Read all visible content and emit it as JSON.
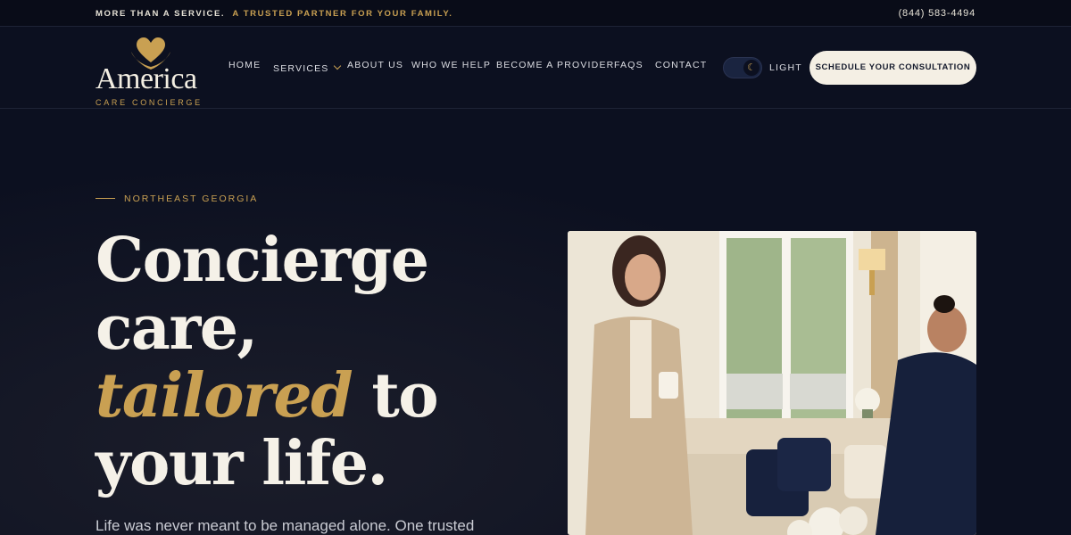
{
  "topbar": {
    "tagline_part1": "MORE THAN A SERVICE.",
    "tagline_part2": "A TRUSTED PARTNER FOR YOUR FAMILY.",
    "phone": "(844) 583-4494"
  },
  "logo": {
    "name": "America",
    "sub": "CARE CONCIERGE",
    "icon": "heart-hands-icon"
  },
  "nav": {
    "home": "HOME",
    "services": "SERVICES",
    "about": "ABOUT US",
    "who_we_help": "WHO WE HELP",
    "become_provider": "BECOME A PROVIDER",
    "faqs": "FAQS",
    "contact": "CONTACT"
  },
  "theme_toggle": {
    "label": "LIGHT",
    "icon": "moon-icon"
  },
  "cta": {
    "label": "SCHEDULE YOUR CONSULTATION"
  },
  "hero": {
    "eyebrow": "NORTHEAST GEORGIA",
    "headline_1": "Concierge",
    "headline_2": "care,",
    "headline_accent": "tailored",
    "headline_3": " to",
    "headline_4": "your life.",
    "lede": "Life was never meant to be managed alone. One trusted"
  },
  "colors": {
    "background": "#0c1020",
    "accent_gold": "#c9a052",
    "cream": "#f4efe4"
  }
}
